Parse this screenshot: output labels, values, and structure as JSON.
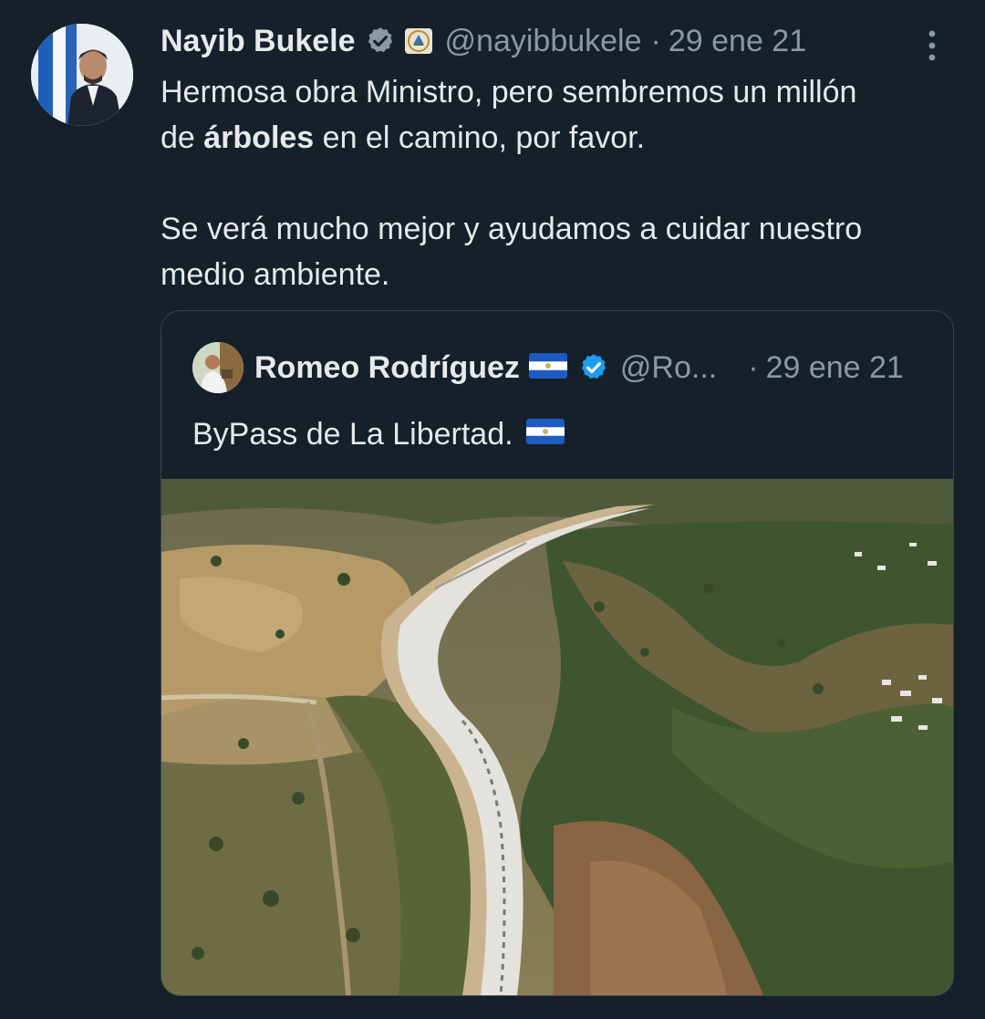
{
  "tweet": {
    "author": {
      "name": "Nayib Bukele",
      "handle": "@nayibbukele",
      "verified_icon": "verified-badge-icon",
      "affiliation_icon": "government-seal-icon"
    },
    "separator": "·",
    "date": "29 ene 21",
    "more_icon": "more-options-icon",
    "text": {
      "line1": "Hermosa obra Ministro, pero sembremos un millón",
      "line2_before": "de ",
      "line2_bold": "árboles",
      "line2_after": " en el camino, por favor.",
      "paragraph2_line1": "Se verá mucho mejor y ayudamos a cuidar nuestro",
      "paragraph2_line2": "medio ambiente."
    }
  },
  "quoted_tweet": {
    "author": {
      "name": "Romeo Rodríguez",
      "handle": "@Ro...",
      "flag_icon": "el-salvador-flag-icon",
      "verified_icon": "verified-badge-icon"
    },
    "separator": "·",
    "date": "29 ene 21",
    "text": "ByPass de La Libertad.",
    "media": "aerial-photo-road"
  },
  "colors": {
    "background": "#15202b",
    "text_primary": "#e7e9ea",
    "text_secondary": "#8b98a5",
    "border": "#38444d",
    "verified": "#1d9bf0"
  }
}
